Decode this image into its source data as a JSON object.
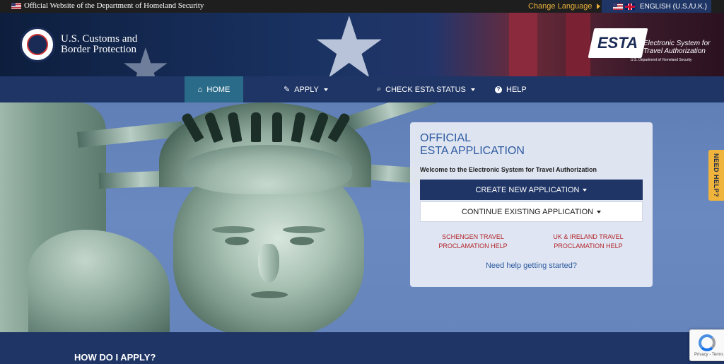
{
  "topbar": {
    "official_text": "Official Website of the Department of Homeland Security",
    "change_language": "Change Language",
    "language": "ENGLISH (U.S./U.K.)"
  },
  "header": {
    "agency_line1": "U.S. Customs and",
    "agency_line2": "Border Protection",
    "esta_logo_text": "ESTA",
    "esta_name_line1": "Electronic System for",
    "esta_name_line2": "Travel Authorization",
    "esta_dept": "U.S. Department of Homeland Security"
  },
  "nav": {
    "items": [
      {
        "label": "HOME",
        "icon": "home-icon"
      },
      {
        "label": "APPLY",
        "icon": "pencil-icon"
      },
      {
        "label": "CHECK ESTA STATUS",
        "icon": "search-icon"
      },
      {
        "label": "HELP",
        "icon": "question-circle-icon"
      }
    ]
  },
  "card": {
    "title": "OFFICIAL\nESTA APPLICATION",
    "welcome": "Welcome to the Electronic System for Travel Authorization",
    "create_button": "CREATE NEW APPLICATION",
    "continue_button": "CONTINUE EXISTING APPLICATION",
    "schengen_link": "SCHENGEN TRAVEL\nPROCLAMATION HELP",
    "uk_link": "UK & IRELAND TRAVEL\nPROCLAMATION HELP",
    "help_link": "Need help getting started?"
  },
  "side_tab": {
    "label": "NEED HELP?"
  },
  "bottom": {
    "title": "HOW DO I APPLY?"
  },
  "recaptcha": {
    "links": "Privacy - Terms"
  },
  "colors": {
    "navy": "#1f3566",
    "active_tab": "#2b6b8a",
    "link_red": "#b3272d",
    "link_blue": "#2c5aa0",
    "accent_gold": "#f0b43c"
  }
}
